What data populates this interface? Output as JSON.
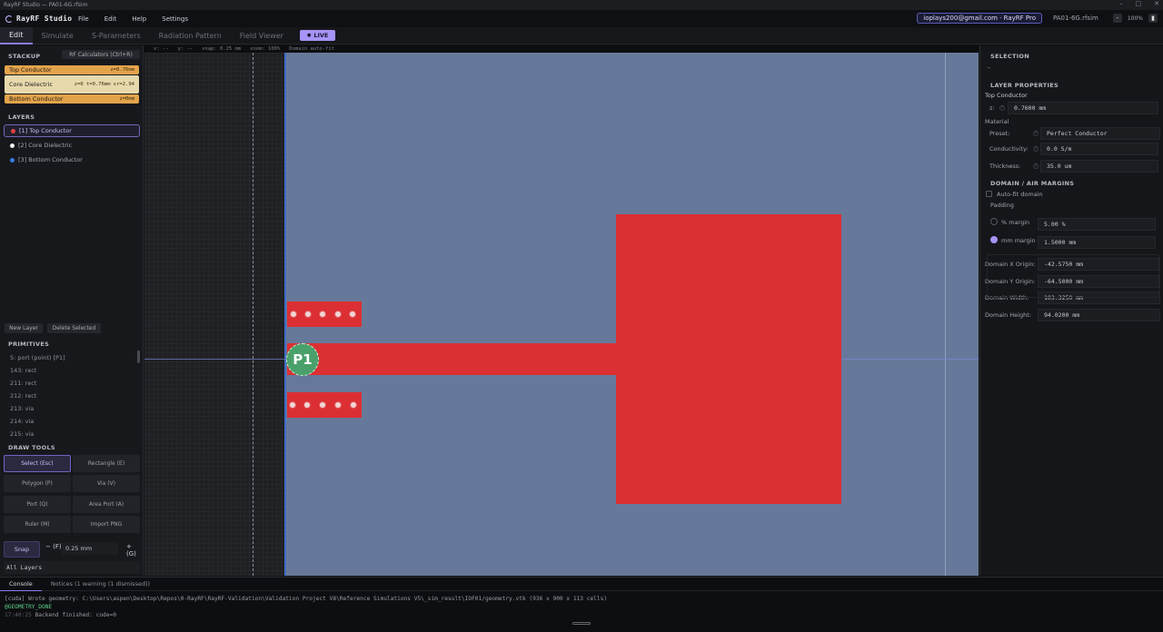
{
  "window": {
    "title": "RayRF Studio — PA01-6G.rfsim",
    "controls": [
      "–",
      "□",
      "✕"
    ]
  },
  "menubar": {
    "app_name": "RayRF Studio",
    "menus": [
      "File",
      "Edit",
      "Help",
      "Settings"
    ],
    "account": "ioplays200@gmail.com · RayRF Pro",
    "filename": "PA01-6G.rfsim",
    "zoom_minus": "-",
    "zoom_value": "100%",
    "zoom_icon": "▮"
  },
  "tabs": {
    "items": [
      "Edit",
      "Simulate",
      "S-Parameters",
      "Radiation Pattern",
      "Field Viewer"
    ],
    "active": "Edit",
    "live_label": "LIVE",
    "live_icon": "●"
  },
  "left": {
    "stackup_title": "STACKUP",
    "rf_calc_label": "RF Calculators (Ctrl+R)",
    "stackup": [
      {
        "name": "Top Conductor",
        "value": "z=0.76mm",
        "color": "#e3a34b"
      },
      {
        "name": "Core Dielectric",
        "value": "z=0  t=0.76mm  εr=2.94",
        "color": "#e8d9ad"
      },
      {
        "name": "Bottom Conductor",
        "value": "z=0mm",
        "color": "#e3a34b"
      }
    ],
    "layers_title": "LAYERS",
    "layers": [
      {
        "label": "[1] Top Conductor",
        "color": "#e04040"
      },
      {
        "label": "[2] Core Dielectric",
        "color": "#f0f0f0"
      },
      {
        "label": "[3] Bottom Conductor",
        "color": "#3a7be0"
      }
    ],
    "new_layer": "New Layer",
    "delete_selected": "Delete Selected",
    "primitives_title": "PRIMITIVES",
    "primitives": [
      "5: port (point) [P1]",
      "143: rect",
      "211: rect",
      "212: rect",
      "213: via",
      "214: via",
      "215: via"
    ],
    "draw_tools_title": "DRAW TOOLS",
    "tools": [
      "Select (Esc)",
      "Rectangle (E)",
      "Polygon (P)",
      "Via (V)",
      "Port (Q)",
      "Area Port (A)",
      "Ruler (M)",
      "Import PNG"
    ],
    "snap_label": "Snap",
    "snap_minus": "− (F)",
    "snap_value": "0.25 mm",
    "snap_plus": "+ (G)",
    "layer_filter": "All Layers"
  },
  "canvas": {
    "coord_x": "x: --",
    "coord_y": "y: --",
    "snap": "snap: 0.25 mm",
    "zoom": "zoom: 100%",
    "domain_mode": "Domain auto-fit",
    "port_label": "P1"
  },
  "right": {
    "selection_title": "SELECTION",
    "selection_value": "–",
    "layer_props_title": "LAYER PROPERTIES",
    "layer_name": "Top Conductor",
    "z_label": "z:",
    "z_value": "0.7600 mm",
    "material_label": "Material",
    "preset_label": "Preset:",
    "preset_value": "Perfect Conductor",
    "conductivity_label": "Conductivity:",
    "conductivity_value": "0.0 S/m",
    "thickness_label": "Thickness:",
    "thickness_value": "35.0 um",
    "domain_title": "DOMAIN / AIR MARGINS",
    "autofit_label": "Auto-fit domain",
    "padding_label": "Padding",
    "pct_margin_label": "% margin",
    "pct_margin_value": "5.00 %",
    "mm_margin_label": "mm margin",
    "mm_margin_value": "1.5000 mm",
    "domain_x_label": "Domain X Origin:",
    "domain_x_value": "-42.5750 mm",
    "domain_y_label": "Domain Y Origin:",
    "domain_y_value": "-64.5000 mm",
    "domain_w_label": "Domain Width:",
    "domain_w_value": "103.3250 mm",
    "domain_h_label": "Domain Height:",
    "domain_h_value": "94.0200 mm"
  },
  "console": {
    "tabs": [
      "Console",
      "Notices (1 warning (1 dismissed))"
    ],
    "line1": "[cuda] Wrote geometry: C:\\Users\\aspen\\Desktop\\Repos\\0-RayRF\\RayRF-Validation\\Validation Project V8\\Reference Simulations V5\\_sim_result\\IOF01/geometry.vtk  (936 x 900 x 113 cells)",
    "line2": "@GEOMETRY_DONE",
    "line3_time": "17:40:25",
    "line3_text": "Backend finished: code=0"
  }
}
